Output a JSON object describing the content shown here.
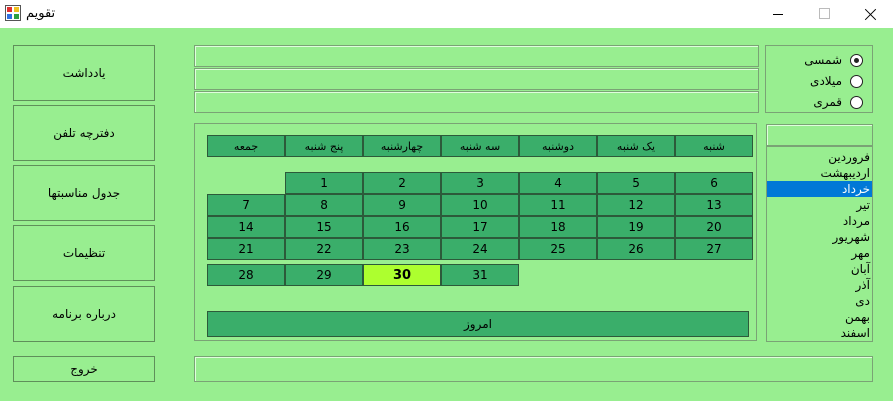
{
  "window": {
    "title": "تقویم"
  },
  "left_buttons": [
    "یادداشت",
    "دفترچه تلفن",
    "جدول مناسبتها",
    "تنظیمات",
    "درباره برنامه"
  ],
  "exit_label": "خروج",
  "calendar_types": [
    {
      "label": "شمسی",
      "checked": true
    },
    {
      "label": "میلادی",
      "checked": false
    },
    {
      "label": "قمری",
      "checked": false
    }
  ],
  "weekdays": [
    "شنبه",
    "یک شنبه",
    "دوشنبه",
    "سه شنبه",
    "چهارشنبه",
    "پنج شنبه",
    "جمعه"
  ],
  "days": [
    "1",
    "2",
    "3",
    "4",
    "5",
    "6",
    "7",
    "8",
    "9",
    "10",
    "11",
    "12",
    "13",
    "14",
    "15",
    "16",
    "17",
    "18",
    "19",
    "20",
    "21",
    "22",
    "23",
    "24",
    "25",
    "26",
    "27",
    "28",
    "29",
    "30",
    "31"
  ],
  "first_day_column": 1,
  "today_day": "30",
  "today_label": "امروز",
  "months": [
    "فروردین",
    "اردیبهشت",
    "خرداد",
    "تیر",
    "مرداد",
    "شهریور",
    "مهر",
    "آبان",
    "آذر",
    "دی",
    "بهمن",
    "اسفند"
  ],
  "selected_month": "خرداد",
  "colors": {
    "background": "#98ee90",
    "cell": "#3aae6a",
    "today": "#adff2f",
    "selection": "#0078d7"
  }
}
